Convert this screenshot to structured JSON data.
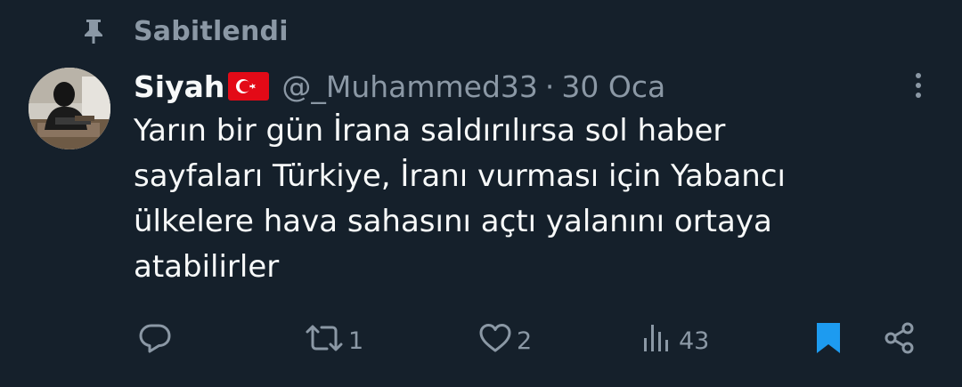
{
  "pinned": {
    "label": "Sabitlendi",
    "icon": "pin-icon"
  },
  "author": {
    "display_name": "Siyah",
    "flag": "turkey-flag",
    "handle": "@_Muhammed33",
    "separator": "·",
    "date": "30 Oca"
  },
  "tweet": {
    "lines": [
      "Yarın bir gün İrana saldırılırsa sol haber",
      "sayfaları Türkiye, İranı vurması için Yabancı",
      "ülkelere hava sahasını açtı yalanını ortaya",
      "atabilirler"
    ]
  },
  "actions": {
    "reply": {
      "icon": "reply-icon",
      "count": ""
    },
    "retweet": {
      "icon": "retweet-icon",
      "count": "1"
    },
    "like": {
      "icon": "heart-icon",
      "count": "2"
    },
    "views": {
      "icon": "views-icon",
      "count": "43"
    },
    "bookmark": {
      "icon": "bookmark-icon",
      "active": true
    },
    "share": {
      "icon": "share-icon"
    }
  },
  "colors": {
    "background": "#15202b",
    "text_primary": "#f7f9f9",
    "text_secondary": "#8b98a5",
    "accent": "#1d9bf0",
    "flag_red": "#e30a17"
  }
}
